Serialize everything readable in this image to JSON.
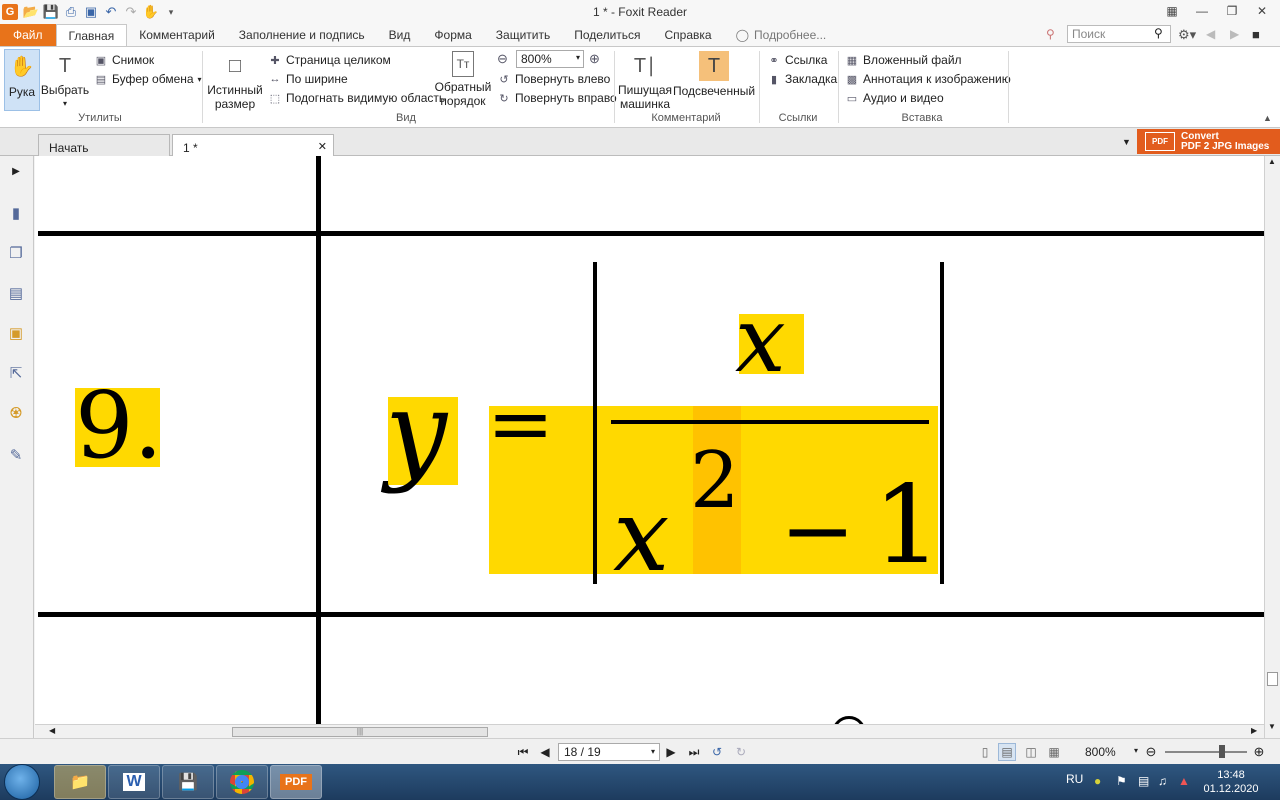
{
  "window": {
    "title": "1 * - Foxit Reader"
  },
  "ribbon_tabs": [
    "Файл",
    "Главная",
    "Комментарий",
    "Заполнение и подпись",
    "Вид",
    "Форма",
    "Защитить",
    "Поделиться",
    "Справка"
  ],
  "tell_me": "Подробнее...",
  "search": {
    "placeholder": "Поиск"
  },
  "ribbon": {
    "utilities": {
      "label": "Утилиты",
      "hand": "Рука",
      "select": "Выбрать",
      "snapshot": "Снимок",
      "clipboard": "Буфер обмена"
    },
    "view": {
      "label": "Вид",
      "actual_size": [
        "Истинный",
        "размер"
      ],
      "fit_page": "Страница целиком",
      "fit_width": "По ширине",
      "fit_visible": "Подогнать видимую область",
      "reflow": [
        "Обратный",
        "порядок"
      ],
      "zoom_value": "800%",
      "rotate_left": "Повернуть влево",
      "rotate_right": "Повернуть вправо"
    },
    "comment": {
      "label": "Комментарий",
      "typewriter": [
        "Пишущая",
        "машинка"
      ],
      "highlight": "Подсвеченный"
    },
    "links": {
      "label": "Ссылки",
      "link": "Ссылка",
      "bookmark": "Закладка"
    },
    "insert": {
      "label": "Вставка",
      "file_attachment": "Вложенный файл",
      "image_annotation": "Аннотация к изображению",
      "audio_video": "Аудио и видео"
    }
  },
  "doc_tabs": [
    "Начать",
    "1 *"
  ],
  "promo": {
    "line1": "Convert",
    "line2": "PDF 2 JPG Images"
  },
  "document": {
    "item_number": "9.",
    "formula": {
      "lhs": "y",
      "equals": "=",
      "numerator": "x",
      "denominator_base": "x",
      "exponent": "2",
      "minus": "−",
      "one": "1"
    }
  },
  "status": {
    "page": "18 / 19",
    "zoom": "800%"
  },
  "taskbar": {
    "lang": "RU",
    "time": "13:48",
    "date": "01.12.2020"
  }
}
